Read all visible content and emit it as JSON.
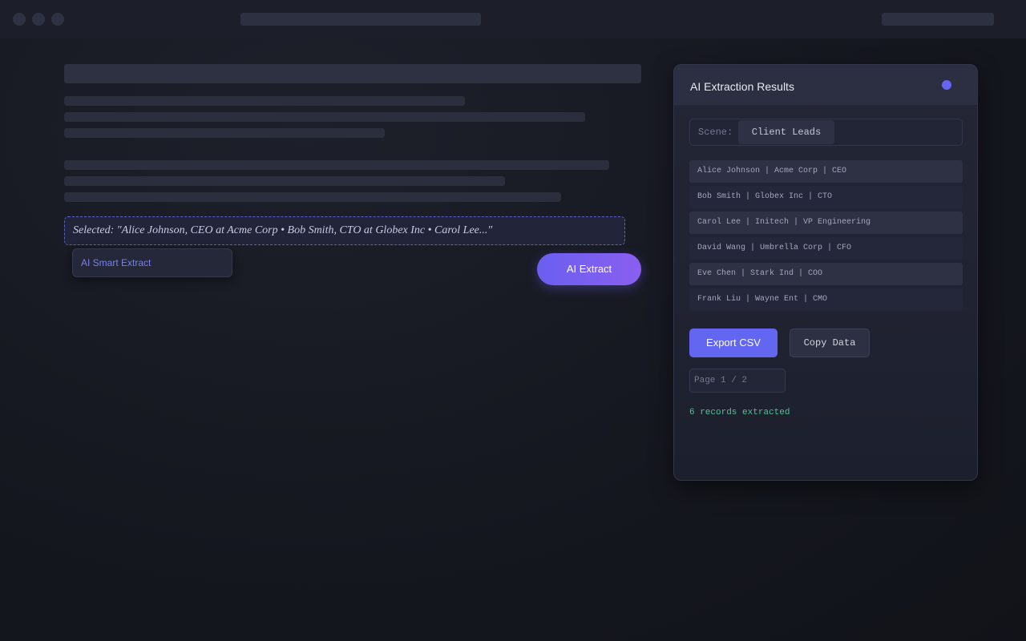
{
  "document": {
    "selection_text": "Selected: \"Alice Johnson, CEO at Acme Corp • Bob Smith, CTO at Globex Inc • Carol Lee...\"",
    "context_menu_label": "AI Smart Extract",
    "extract_button_label": "AI Extract"
  },
  "panel": {
    "title": "AI Extraction Results",
    "status_color": "#6366f1",
    "scene": {
      "label": "Scene:",
      "value": "Client Leads"
    },
    "records": [
      "Alice Johnson | Acme Corp | CEO",
      "Bob Smith | Globex Inc | CTO",
      "Carol Lee | Initech | VP Engineering",
      "David Wang | Umbrella Corp | CFO",
      "Eve Chen | Stark Ind | COO",
      "Frank Liu | Wayne Ent | CMO"
    ],
    "export_label": "Export CSV",
    "copy_label": "Copy Data",
    "page_indicator": "Page 1 / 2",
    "count_text": "6 records extracted"
  },
  "colors": {
    "accent": "#6366f1",
    "success": "#4fc490"
  }
}
